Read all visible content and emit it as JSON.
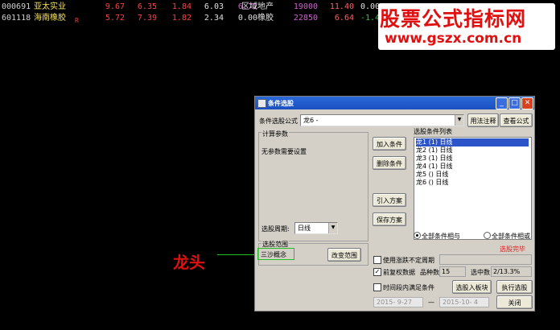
{
  "stocks": [
    {
      "code": "000691",
      "name": "亚太实业",
      "flag": "",
      "price": "9.67",
      "v2": "6.35",
      "v3": "1.84",
      "v4": "6.03",
      "v5": "6.72",
      "industry": "区域地产",
      "v6": "19000",
      "v7": "11.40",
      "v8": "0.00"
    },
    {
      "code": "601118",
      "name": "海南橡胶",
      "flag": "R",
      "price": "5.72",
      "v2": "7.39",
      "v3": "1.82",
      "v4": "2.34",
      "v5": "0.00",
      "industry": "橡胶",
      "v6": "22850",
      "v7": "6.64",
      "v8": "-1.47"
    }
  ],
  "watermark": {
    "line1": "股票公式指标网",
    "line2": "www.gszx.com.cn"
  },
  "annotation": {
    "text": "龙头"
  },
  "dialog": {
    "title": "条件选股",
    "formula_label": "条件选股公式",
    "formula_value": "龙6          -",
    "usage_button": "用法注释",
    "view_formula_button": "查看公式",
    "calc_params_title": "计算参数",
    "no_params_text": "无参数需要设置",
    "add_condition_button": "加入条件",
    "delete_condition_button": "删除条件",
    "import_plan_button": "引入方案",
    "save_plan_button": "保存方案",
    "condition_list_title": "选股条件列表",
    "conditions": [
      "龙1 (1) 日线",
      "龙2 (1) 日线",
      "龙3 (1) 日线",
      "龙4 (1) 日线",
      "龙5 () 日线",
      "龙6 () 日线"
    ],
    "period_label": "选股周期:",
    "period_value": "日线",
    "all_and_label": "全部条件相与",
    "all_or_label": "全部条件相或",
    "status_text": "选股完毕",
    "range_title": "选股范围",
    "range_value": "三沙概念",
    "change_range_button": "改变范围",
    "use_unfixed_period_label": "使用涨跌不定周期",
    "restore_data_label": "前复权数据",
    "stock_count_label": "品种数",
    "stock_count_value": "15",
    "selected_label": "选中数",
    "selected_value": "2/13.3%",
    "time_range_label": "时间段内满足条件",
    "add_to_block_button": "选股入板块",
    "execute_button": "执行选股",
    "date_from": "2015- 9-27",
    "date_sep": "—",
    "date_to": "2015-10- 4",
    "close_button": "关闭"
  }
}
